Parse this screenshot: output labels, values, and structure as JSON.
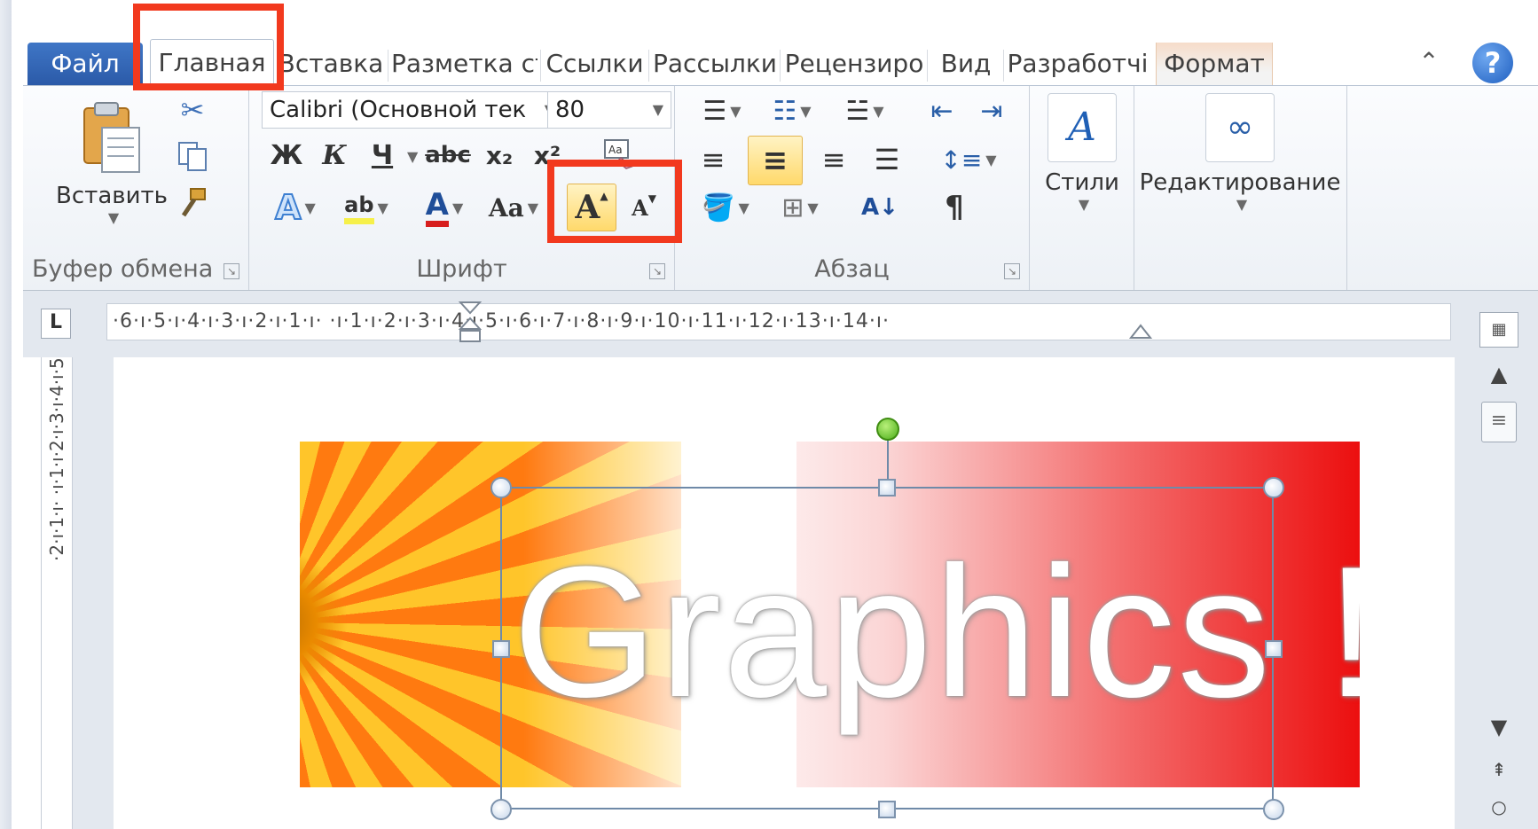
{
  "tabs": [
    {
      "label": "Файл"
    },
    {
      "label": "Главная"
    },
    {
      "label": "Вставка"
    },
    {
      "label": "Разметка ст"
    },
    {
      "label": "Ссылки"
    },
    {
      "label": "Рассылки"
    },
    {
      "label": "Рецензиро"
    },
    {
      "label": "Вид"
    },
    {
      "label": "Разработчі"
    },
    {
      "label": "Формат"
    }
  ],
  "clipboard": {
    "paste_label": "Вставить",
    "group_label": "Буфер обмена"
  },
  "font": {
    "font_name": "Calibri (Основной тек",
    "font_size": "80",
    "group_label": "Шрифт",
    "bold": "Ж",
    "italic": "К",
    "underline": "Ч",
    "strike": "abc",
    "subscript": "x₂",
    "superscript": "x²",
    "change_case": "Aa",
    "grow_font": "A",
    "shrink_font": "A",
    "highlight": "ab",
    "font_color": "A"
  },
  "paragraph": {
    "group_label": "Абзац",
    "pilcrow": "¶"
  },
  "styles": {
    "label": "Стили"
  },
  "editing": {
    "label": "Редактирование"
  },
  "ruler": {
    "tab_marker": "L",
    "horizontal_ticks": "·6·ı·5·ı·4·ı·3·ı·2·ı·1·ı·  ·ı·1·ı·2·ı·3·ı·4·ı·5·ı·6·ı·7·ı·8·ı·9·ı·10·ı·11·ı·12·ı·13·ı·14·ı·",
    "vertical_ticks": "·2·ı·1·ı·  ·ı·1·ı·2·ı·3·ı·4·ı·5"
  },
  "document": {
    "wordart_text": "Graphics !"
  },
  "colors": {
    "file_tab": "#2b5aa8",
    "highlight_box": "#f2391e",
    "active_button": "#ffd96b",
    "banner_red": "#ec0f0f"
  }
}
